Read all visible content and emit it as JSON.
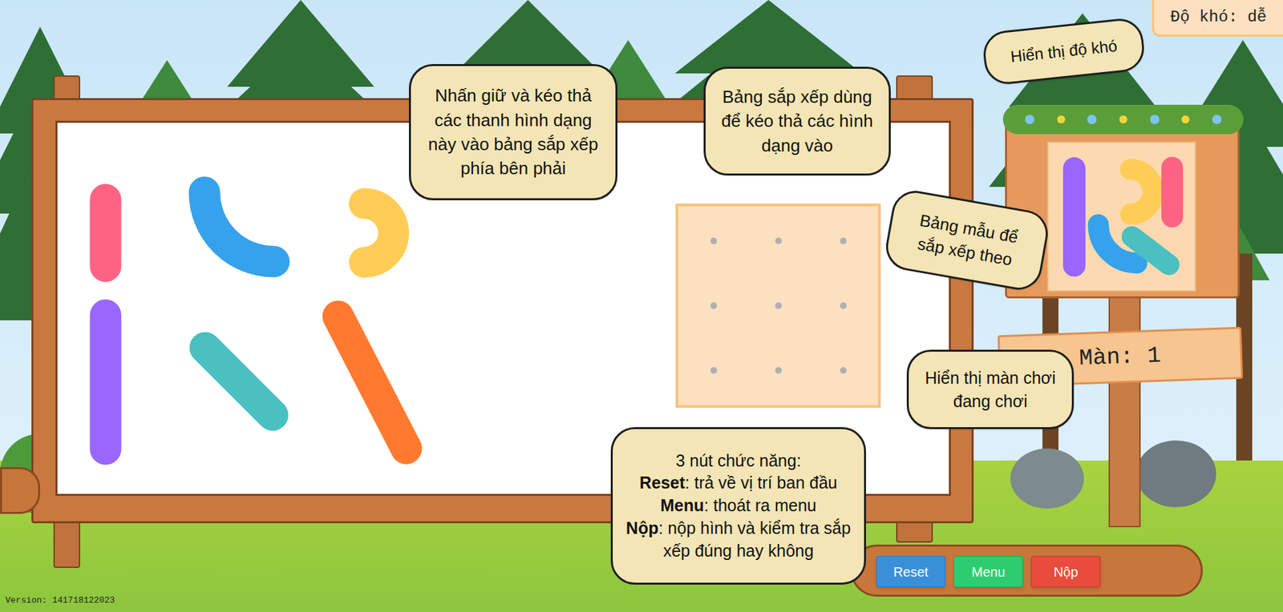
{
  "difficulty": "Độ khó: dễ",
  "level": "Màn: 1",
  "pieces": [
    {
      "kind": "bar",
      "color": "#ff6384"
    },
    {
      "kind": "arc",
      "color": "#36a2eb"
    },
    {
      "kind": "hook",
      "color": "#ffcd56"
    },
    {
      "kind": "bar",
      "color": "#9966ff"
    },
    {
      "kind": "bar",
      "color": "#4bc0c0"
    },
    {
      "kind": "bar",
      "color": "#ff7a2f"
    }
  ],
  "template": [
    {
      "kind": "bar",
      "color": "#9966ff"
    },
    {
      "kind": "arc",
      "color": "#36a2eb"
    },
    {
      "kind": "hook",
      "color": "#ffcd56"
    },
    {
      "kind": "bar",
      "color": "#ff6384"
    },
    {
      "kind": "bar",
      "color": "#4bc0c0"
    }
  ],
  "callouts": [
    {
      "text": "Nhấn giữ và kéo thả các thanh hình dạng này vào bảng sắp xếp phía bên phải"
    },
    {
      "text": "Bảng sắp xếp dùng để kéo thả các hình dạng vào"
    },
    {
      "text": "Hiển thị độ khó"
    },
    {
      "text": "Bảng mẫu để sắp xếp theo"
    },
    {
      "text": "Hiển thị màn chơi đang chơi"
    }
  ],
  "help": {
    "title": "3 nút chức năng:",
    "items": [
      {
        "key": "Reset",
        "text": ": trả về vị trí ban đầu"
      },
      {
        "key": "Menu",
        "text": ": thoát ra menu"
      },
      {
        "key": "Nộp",
        "text": ": nộp hình và kiểm tra sắp xếp đúng hay không"
      }
    ]
  },
  "buttons": [
    {
      "label": "Reset",
      "color": "#3a8fd9"
    },
    {
      "label": "Menu",
      "color": "#2ecc71"
    },
    {
      "label": "Nộp",
      "color": "#e74c3c"
    }
  ],
  "version": "Version: 141718122023"
}
